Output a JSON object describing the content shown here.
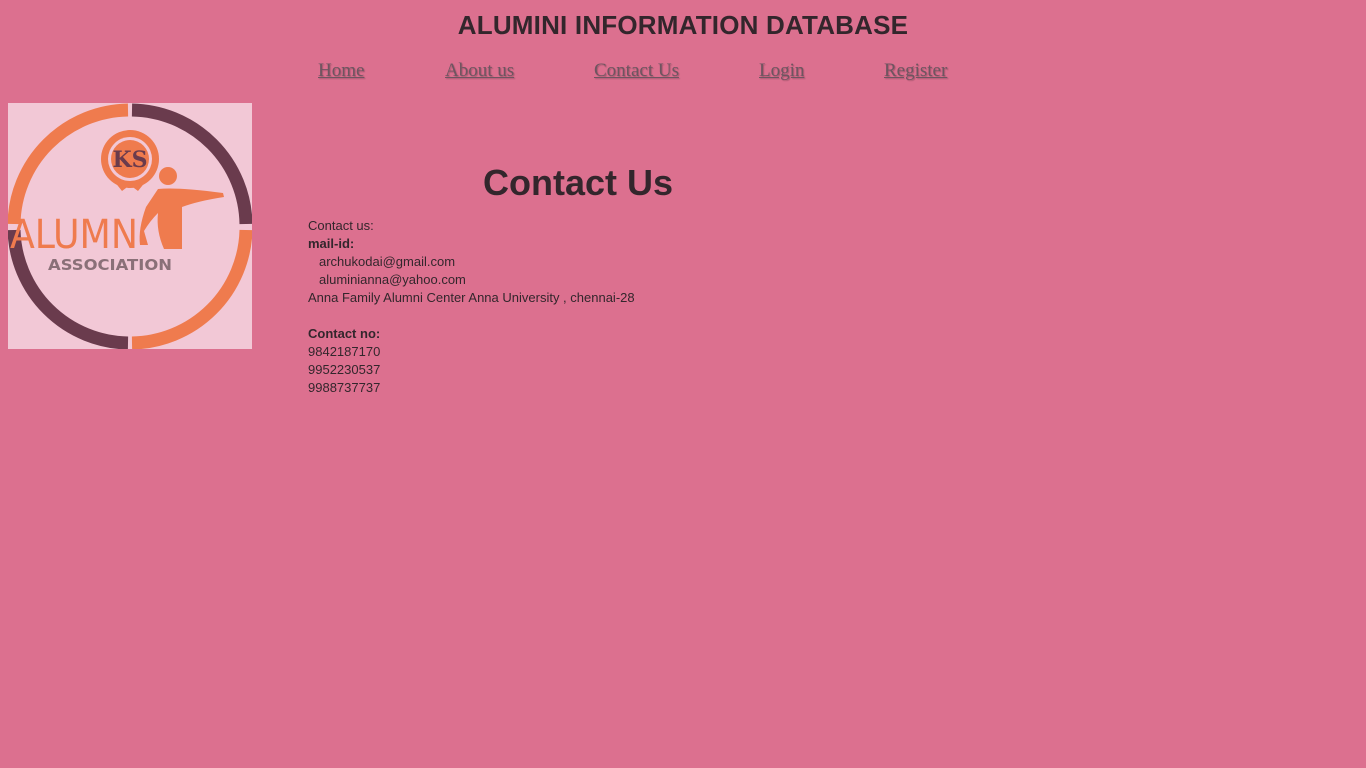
{
  "header": {
    "title": "ALUMINI INFORMATION DATABASE"
  },
  "nav": {
    "items": [
      {
        "label": "Home"
      },
      {
        "label": "About us"
      },
      {
        "label": "Contact Us"
      },
      {
        "label": "Login"
      },
      {
        "label": "Register"
      }
    ]
  },
  "logo": {
    "text_main": "ALUMN",
    "text_sub": "ASSOCIATION",
    "emblem_letters": "KS",
    "colors": {
      "orange": "#ef7b4e",
      "maroon": "#6a3b4d",
      "grey": "#8a7078",
      "background": "#f2c8d6"
    }
  },
  "main": {
    "heading": "Contact Us",
    "contact_label": "Contact us:",
    "mail_label": "mail-id:",
    "emails": [
      "archukodai@gmail.com",
      "aluminianna@yahoo.com"
    ],
    "address": "Anna Family Alumni Center Anna University , chennai-28",
    "phone_label": "Contact no:",
    "phones": [
      "9842187170",
      "9952230537",
      "9988737737"
    ]
  },
  "theme": {
    "background": "#dc708f",
    "text": "#33262c",
    "link": "#6e5560"
  }
}
